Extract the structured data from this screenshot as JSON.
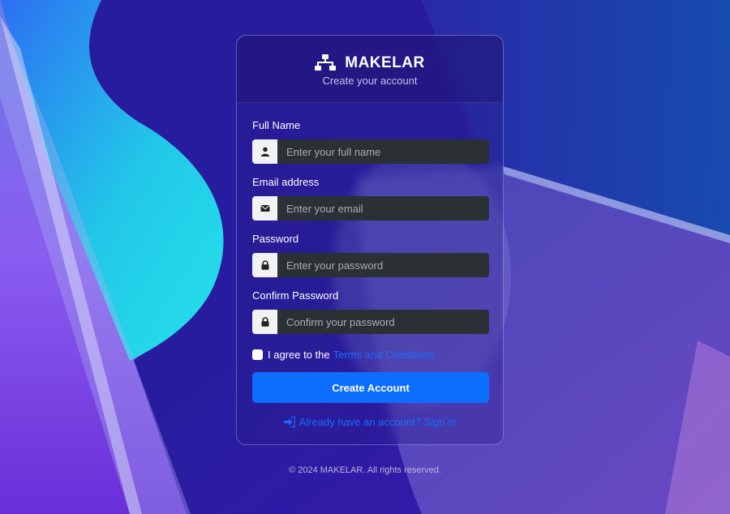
{
  "brand": {
    "name": "MAKELAR",
    "subtitle": "Create your account",
    "icon": "sitemap-icon"
  },
  "form": {
    "full_name": {
      "label": "Full Name",
      "placeholder": "Enter your full name",
      "icon": "user-icon"
    },
    "email": {
      "label": "Email address",
      "placeholder": "Enter your email",
      "icon": "envelope-icon"
    },
    "password": {
      "label": "Password",
      "placeholder": "Enter your password",
      "icon": "lock-icon"
    },
    "confirm_password": {
      "label": "Confirm Password",
      "placeholder": "Confirm your password",
      "icon": "lock-icon"
    },
    "terms": {
      "prefix": "I agree to the",
      "link": "Terms and Conditions",
      "checked": false
    },
    "submit_label": "Create Account"
  },
  "signin": {
    "label": "Already have an account? Sign in",
    "icon": "sign-in-icon"
  },
  "footer": {
    "text": "© 2024 MAKELAR. All rights reserved."
  },
  "colors": {
    "primary": "#0d6efd",
    "link": "#1a6cff",
    "input_bg": "#2b3035"
  }
}
